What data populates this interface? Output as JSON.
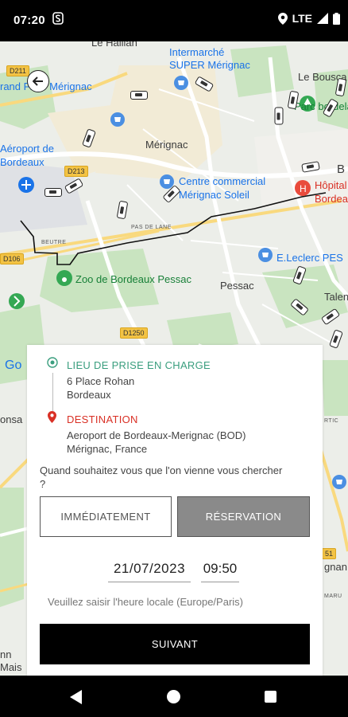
{
  "status_bar": {
    "time": "07:20",
    "network": "LTE"
  },
  "map": {
    "labels": {
      "le_haillan": "Le Haillan",
      "intermarche": "Intermarché\nSUPER Mérignac",
      "le_bouscat": "Le Bousca",
      "parc_bordelais": "Parc bordelais",
      "grand_frais": "rand Frais Mérignac",
      "aeroport": "Aéroport de\nBordeaux",
      "merignac": "Mérignac",
      "centre_commercial": "Centre commercial\nMérignac Soleil",
      "hopital": "Hôpital\nBordea",
      "pas_de_lane": "PAS DE LANE",
      "beutre": "BEUTRE",
      "zoo": "Zoo de Bordeaux Pessac",
      "leclerc": "E.Leclerc PES",
      "pessac": "Pessac",
      "talence": "Talen",
      "b_letter": "B",
      "google": "Go",
      "onsac": "onsa",
      "mais": "Mais",
      "gnan": "gnan",
      "rtic": "RTIC",
      "maru": "MARU",
      "bordeaux_left": "nn"
    },
    "road_badges": [
      "D211",
      "D213",
      "D106",
      "D1250",
      "51"
    ]
  },
  "booking": {
    "pickup_label": "LIEU DE PRISE EN CHARGE",
    "pickup_line1": "6 Place Rohan",
    "pickup_line2": "Bordeaux",
    "destination_label": "DESTINATION",
    "destination_line1": "Aeroport de Bordeaux-Merignac (BOD)",
    "destination_line2": "Mérignac, France",
    "question": "Quand souhaitez vous que l'on vienne vous chercher ?",
    "immediate_label": "IMMÉDIATEMENT",
    "reservation_label": "RÉSERVATION",
    "date_value": "21/07/2023",
    "time_value": "09:50",
    "timezone_hint": "Veuillez saisir l'heure locale (Europe/Paris)",
    "next_label": "SUIVANT"
  },
  "colors": {
    "pickup_accent": "#3a9e7e",
    "destination_accent": "#d93025",
    "selected_option": "#8a8a8a"
  }
}
